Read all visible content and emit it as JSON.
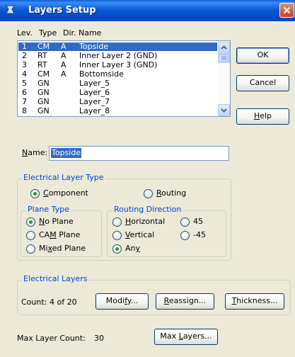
{
  "window": {
    "title": "Layers Setup"
  },
  "list": {
    "headers": [
      "Lev.",
      "Type",
      "Dir.",
      "Name"
    ],
    "rows": [
      {
        "lev": "1",
        "type": "CM",
        "dir": "A",
        "name": "Topside"
      },
      {
        "lev": "2",
        "type": "RT",
        "dir": "A",
        "name": "Inner Layer 2 (GND)"
      },
      {
        "lev": "3",
        "type": "RT",
        "dir": "A",
        "name": "Inner Layer 3 (GND)"
      },
      {
        "lev": "4",
        "type": "CM",
        "dir": "A",
        "name": "Bottomside"
      },
      {
        "lev": "5",
        "type": "GN",
        "dir": "",
        "name": "Layer_5"
      },
      {
        "lev": "6",
        "type": "GN",
        "dir": "",
        "name": "Layer_6"
      },
      {
        "lev": "7",
        "type": "GN",
        "dir": "",
        "name": "Layer_7"
      },
      {
        "lev": "8",
        "type": "GN",
        "dir": "",
        "name": "Layer_8"
      }
    ]
  },
  "buttons": {
    "ok": "OK",
    "cancel": "Cancel",
    "help": "Help"
  },
  "name_field": {
    "label": "Name:",
    "value": "Topside"
  },
  "electrical_layer_type": {
    "title": "Electrical Layer Type",
    "component": "Component",
    "routing": "Routing",
    "selected": "Component"
  },
  "plane_type": {
    "title": "Plane Type",
    "options": [
      "No Plane",
      "CAM Plane",
      "Mixed Plane"
    ],
    "selected": "No Plane"
  },
  "routing_direction": {
    "title": "Routing Direction",
    "options": [
      "Horizontal",
      "Vertical",
      "Any",
      "45",
      "-45"
    ],
    "selected": "Any"
  },
  "electrical_layers": {
    "title": "Electrical Layers",
    "count_label": "Count:",
    "count_value": "4 of 20",
    "modify": "Modify...",
    "reassign": "Reassign...",
    "thickness": "Thickness..."
  },
  "max_layer": {
    "label": "Max Layer Count:",
    "value": "30",
    "button": "Max Layers..."
  },
  "colors": {
    "title_bar": "#0a5bd6",
    "selection": "#316ac5",
    "group_title": "#0046d5",
    "dialog_bg": "#ece9d8"
  }
}
